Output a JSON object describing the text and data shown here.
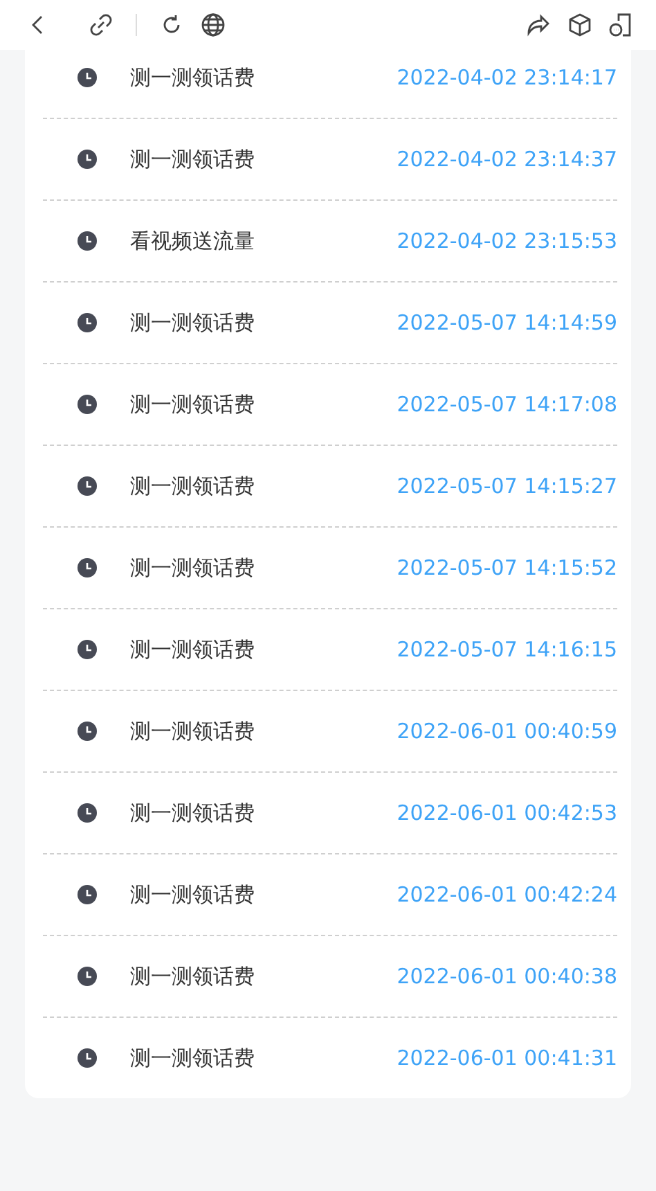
{
  "records": [
    {
      "title": "测一测领话费",
      "time": "2022-04-02 23:14:17"
    },
    {
      "title": "测一测领话费",
      "time": "2022-04-02 23:14:37"
    },
    {
      "title": "看视频送流量",
      "time": "2022-04-02 23:15:53"
    },
    {
      "title": "测一测领话费",
      "time": "2022-05-07 14:14:59"
    },
    {
      "title": "测一测领话费",
      "time": "2022-05-07 14:17:08"
    },
    {
      "title": "测一测领话费",
      "time": "2022-05-07 14:15:27"
    },
    {
      "title": "测一测领话费",
      "time": "2022-05-07 14:15:52"
    },
    {
      "title": "测一测领话费",
      "time": "2022-05-07 14:16:15"
    },
    {
      "title": "测一测领话费",
      "time": "2022-06-01 00:40:59"
    },
    {
      "title": "测一测领话费",
      "time": "2022-06-01 00:42:53"
    },
    {
      "title": "测一测领话费",
      "time": "2022-06-01 00:42:24"
    },
    {
      "title": "测一测领话费",
      "time": "2022-06-01 00:40:38"
    },
    {
      "title": "测一测领话费",
      "time": "2022-06-01 00:41:31"
    }
  ]
}
